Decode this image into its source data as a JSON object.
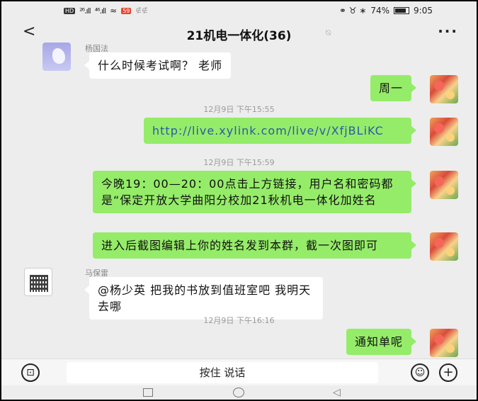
{
  "status_bar": {
    "hd_badge": "HD",
    "signal1": "²⁶.ıll",
    "signal2": "⁴⁶.ıll",
    "wifi": "≈",
    "app_badge": "59",
    "app_tag": "∉∉",
    "right_icons": "⚭ ♉ ∗",
    "battery_pct": "74%",
    "time": "9:05"
  },
  "header": {
    "back": "<",
    "title": "21机电一体化(36)",
    "mute": "⍉",
    "more": "···"
  },
  "messages": [
    {
      "sender": "杨国法",
      "text": "什么时候考试啊？ 老师"
    },
    {
      "text": "周一"
    },
    {
      "time": "12月9日 下午15:55"
    },
    {
      "text": "http://live.xylink.com/live/v/XfjBLiKC"
    },
    {
      "time": "12月9日 下午15:59"
    },
    {
      "text": "今晚19：00—20：00点击上方链接，用户名和密码都是“保定开放大学曲阳分校加21秋机电一体化加姓名"
    },
    {
      "text": "进入后截图编辑上你的姓名发到本群，截一次图即可"
    },
    {
      "sender": "马保雷",
      "text": "@杨少英  把我的书放到值班室吧 我明天去哪"
    },
    {
      "time": "12月9日 下午16:16"
    },
    {
      "text": "通知单呢"
    }
  ],
  "input_bar": {
    "voice_icon": "⊡",
    "hold_to_talk": "按住 说话",
    "emoji_icon": "☺",
    "plus_icon": "+"
  },
  "nav_bar": {
    "recent": "",
    "home": "",
    "back": "◁"
  }
}
